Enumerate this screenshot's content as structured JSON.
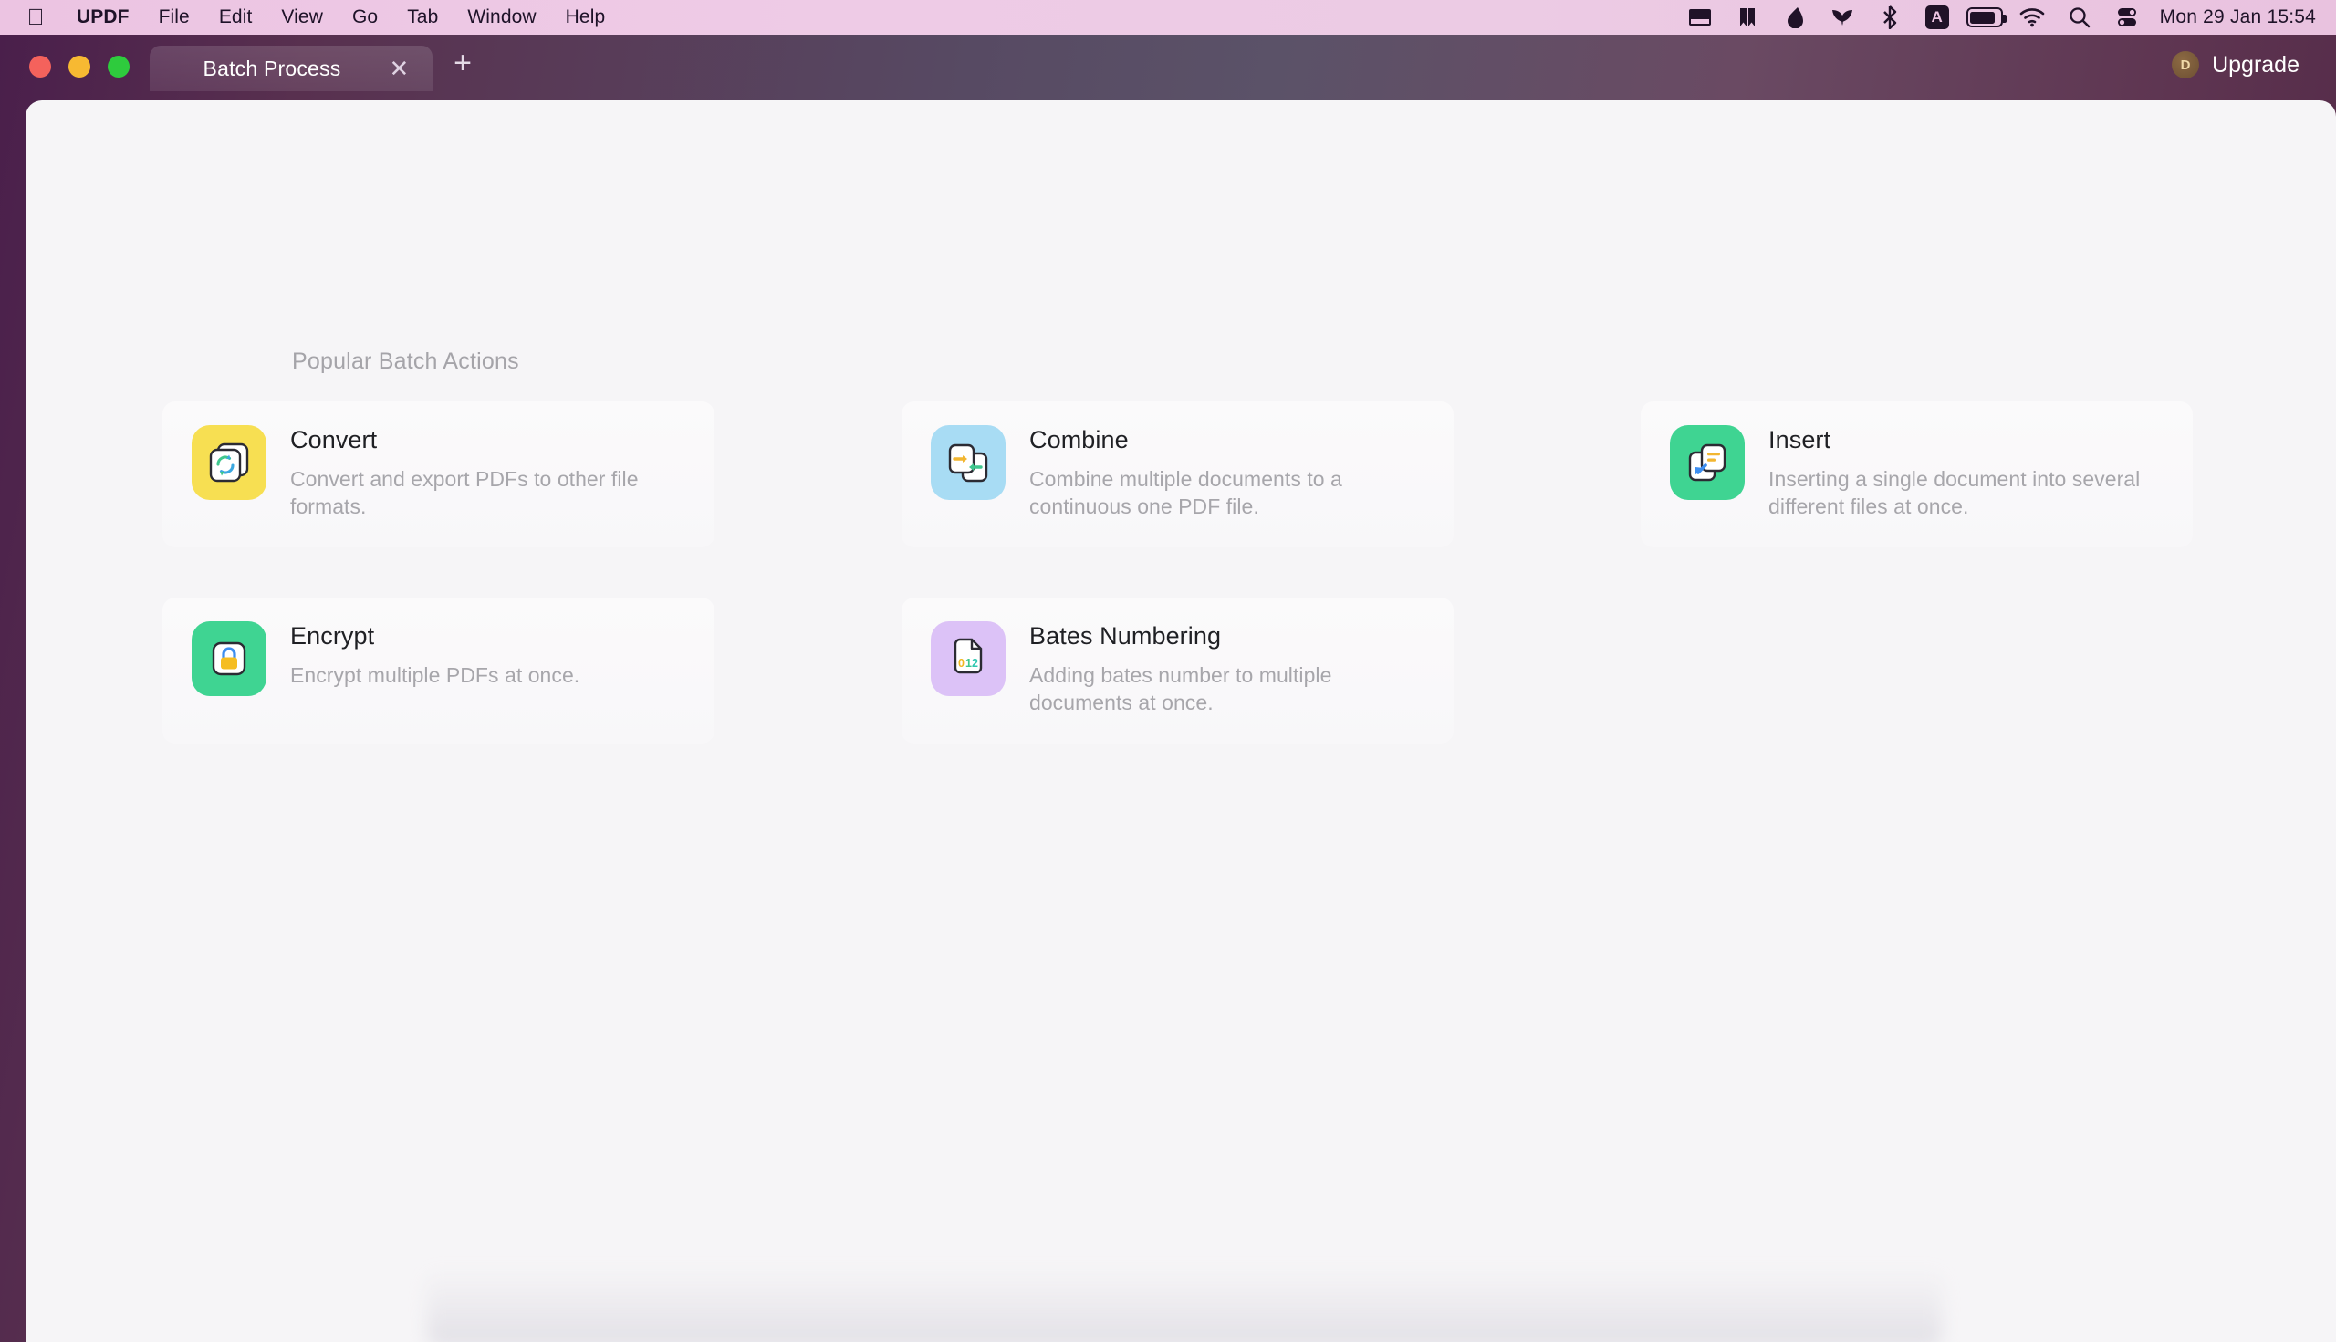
{
  "menubar": {
    "apple_icon": "apple-logo",
    "items": [
      {
        "label": "UPDF",
        "bold": true
      },
      {
        "label": "File",
        "bold": false
      },
      {
        "label": "Edit",
        "bold": false
      },
      {
        "label": "View",
        "bold": false
      },
      {
        "label": "Go",
        "bold": false
      },
      {
        "label": "Tab",
        "bold": false
      },
      {
        "label": "Window",
        "bold": false
      },
      {
        "label": "Help",
        "bold": false
      }
    ],
    "status_icons": [
      "keyboard-icon",
      "bookmark-icon",
      "droplet-icon",
      "flow-icon",
      "bluetooth-icon",
      "input-source-icon",
      "battery-icon",
      "wifi-icon",
      "search-icon",
      "control-center-icon"
    ],
    "input_source_letter": "A",
    "clock": "Mon 29 Jan  15:54"
  },
  "window": {
    "traffic_lights": [
      "close-button",
      "minimize-button",
      "zoom-button"
    ],
    "tab": {
      "title": "Batch Process",
      "close_icon": "close-icon",
      "new_tab_icon": "plus-icon"
    },
    "upgrade": {
      "badge": "D",
      "label": "Upgrade"
    }
  },
  "main": {
    "section_title": "Popular Batch Actions",
    "cards": [
      {
        "id": "convert",
        "title": "Convert",
        "desc": "Convert and export PDFs to other file formats.",
        "icon": "convert-icon",
        "tile_color": "#f7df52"
      },
      {
        "id": "combine",
        "title": "Combine",
        "desc": "Combine multiple documents to a continuous one PDF file.",
        "icon": "combine-icon",
        "tile_color": "#a8dcf4"
      },
      {
        "id": "insert",
        "title": "Insert",
        "desc": "Inserting a single document into several different files at once.",
        "icon": "insert-icon",
        "tile_color": "#3fd492"
      },
      {
        "id": "encrypt",
        "title": "Encrypt",
        "desc": "Encrypt multiple PDFs at once.",
        "icon": "encrypt-icon",
        "tile_color": "#3fd492"
      },
      {
        "id": "bates-numbering",
        "title": "Bates Numbering",
        "desc": "Adding bates number to multiple documents at once.",
        "icon": "bates-numbering-icon",
        "tile_color": "#dcc2f7"
      }
    ],
    "bates_icon_text": "012"
  },
  "colors": {
    "menubar_pink": "#eccbe4",
    "window_purple": "#57386b",
    "content_bg": "#f6f5f7",
    "title_text": "#1f2024",
    "desc_text": "#a7a6ab"
  }
}
